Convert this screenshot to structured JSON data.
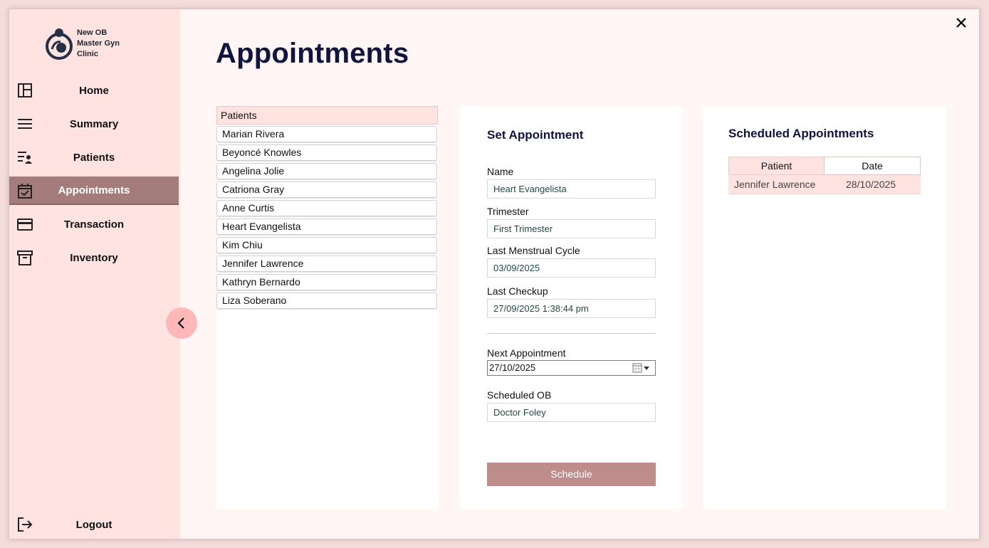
{
  "app": {
    "logo_lines": [
      "New OB",
      "Master Gyn",
      "Clinic"
    ]
  },
  "sidebar": {
    "items": [
      {
        "label": "Home",
        "icon": "dashboard-icon"
      },
      {
        "label": "Summary",
        "icon": "menu-lines-icon"
      },
      {
        "label": "Patients",
        "icon": "patient-list-icon"
      },
      {
        "label": "Appointments",
        "icon": "calendar-check-icon",
        "active": true
      },
      {
        "label": "Transaction",
        "icon": "credit-card-icon"
      },
      {
        "label": "Inventory",
        "icon": "archive-box-icon"
      }
    ],
    "logout_label": "Logout"
  },
  "page": {
    "title": "Appointments"
  },
  "patients": {
    "header": "Patients",
    "list": [
      "Marian Rivera",
      "Beyoncé Knowles",
      "Angelina Jolie",
      "Catriona Gray",
      "Anne Curtis",
      "Heart Evangelista",
      "Kim Chiu",
      "Jennifer Lawrence",
      "Kathryn Bernardo",
      "Liza Soberano"
    ]
  },
  "set_appointment": {
    "title": "Set Appointment",
    "name_label": "Name",
    "name_value": "Heart Evangelista",
    "trimester_label": "Trimester",
    "trimester_value": "First Trimester",
    "lmc_label": "Last Menstrual Cycle",
    "lmc_value": "03/09/2025",
    "last_checkup_label": "Last Checkup",
    "last_checkup_value": "27/09/2025 1:38:44 pm",
    "next_appointment_label": "Next Appointment",
    "next_appointment_value": "27/10/2025",
    "scheduled_ob_label": "Scheduled OB",
    "scheduled_ob_value": "Doctor Foley",
    "schedule_button": "Schedule"
  },
  "scheduled": {
    "title": "Scheduled Appointments",
    "columns": [
      "Patient",
      "Date"
    ],
    "rows": [
      {
        "patient": "Jennifer Lawrence",
        "date": "28/10/2025"
      }
    ]
  },
  "colors": {
    "sidebar_bg": "#ffe3e1",
    "active_nav": "#a47c7c",
    "schedule_button": "#bc8d8b",
    "title": "#0f1440"
  }
}
